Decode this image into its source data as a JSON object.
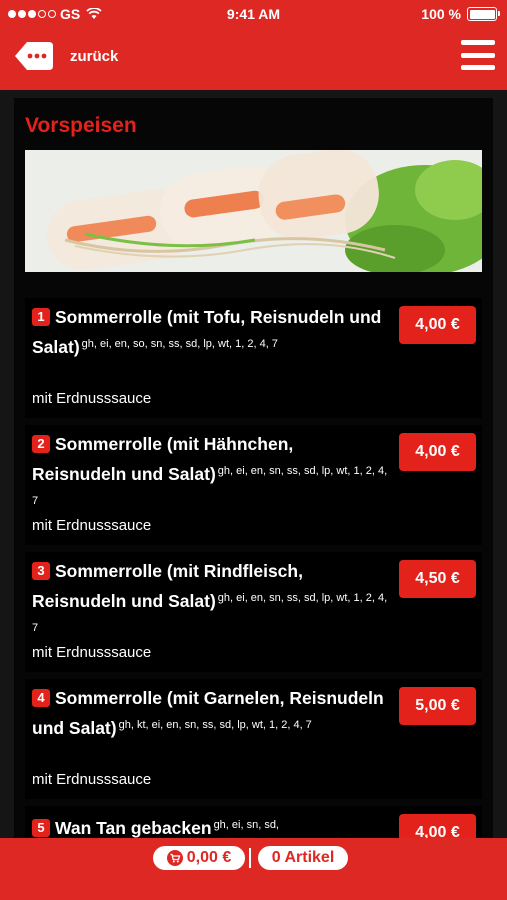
{
  "status_bar": {
    "carrier": "GS",
    "time": "9:41 AM",
    "battery": "100 %"
  },
  "nav": {
    "back_label": "zurück"
  },
  "section": {
    "title": "Vorspeisen"
  },
  "items": [
    {
      "number": "1",
      "name": "Sommerrolle (mit Tofu, Reisnudeln und Salat)",
      "allergens": "gh, ei, en, so, sn, ss, sd, lp, wt, 1, 2, 4, 7",
      "description": "mit Erdnusssauce",
      "price": "4,00 €"
    },
    {
      "number": "2",
      "name": "Sommerrolle (mit Hähnchen, Reisnudeln und Salat)",
      "allergens": "gh, ei, en, sn, ss, sd, lp, wt, 1, 2, 4, 7",
      "description": "mit Erdnusssauce",
      "price": "4,00 €"
    },
    {
      "number": "3",
      "name": "Sommerrolle (mit Rindfleisch, Reisnudeln und Salat)",
      "allergens": "gh, ei, en, sn, ss, sd, lp, wt, 1, 2, 4, 7",
      "description": "mit Erdnusssauce",
      "price": "4,50 €"
    },
    {
      "number": "4",
      "name": "Sommerrolle (mit Garnelen, Reisnudeln und Salat)",
      "allergens": "gh, kt, ei, en, sn, ss, sd, lp, wt, 1, 2, 4, 7",
      "description": "mit Erdnusssauce",
      "price": "5,00 €"
    },
    {
      "number": "5",
      "name": "Wan Tan gebacken",
      "allergens": "gh, ei, sn, sd,",
      "description": "",
      "price": "4,00 €"
    }
  ],
  "cart": {
    "total": "0,00 €",
    "count": "0 Artikel"
  },
  "colors": {
    "brand_red": "#de2823",
    "background": "#060606"
  }
}
